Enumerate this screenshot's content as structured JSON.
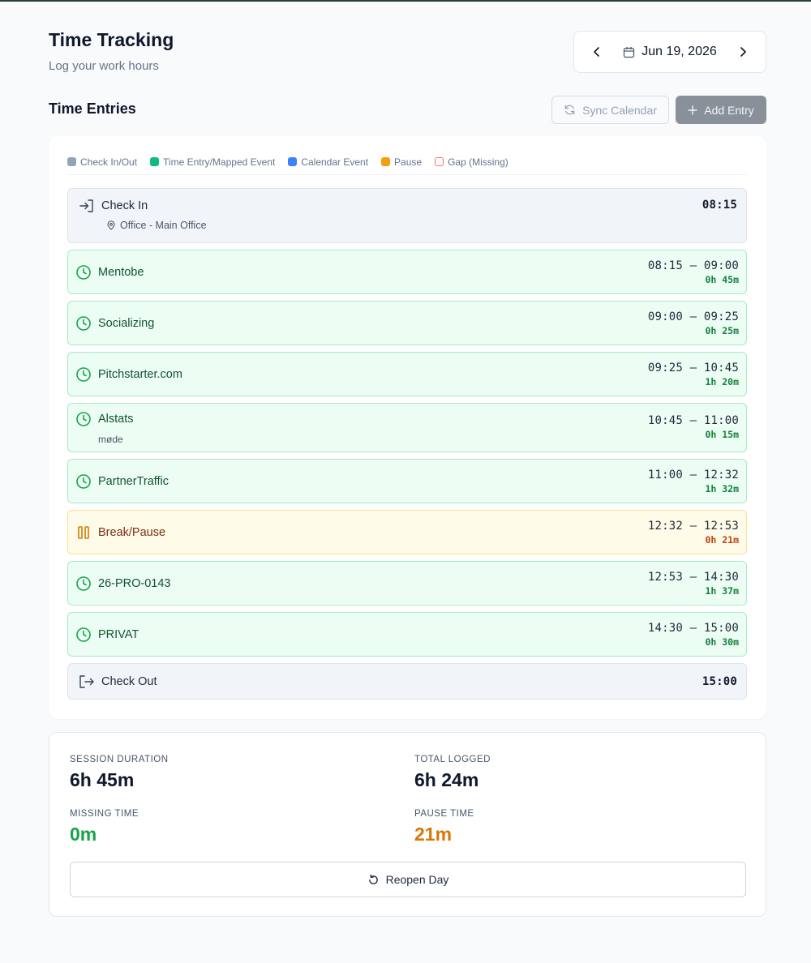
{
  "header": {
    "title": "Time Tracking",
    "subtitle": "Log your work hours",
    "date": "Jun 19, 2026"
  },
  "section": {
    "title": "Time Entries",
    "sync_label": "Sync Calendar",
    "add_label": "Add Entry"
  },
  "legend": [
    {
      "label": "Check In/Out",
      "color": "#94a3b8"
    },
    {
      "label": "Time Entry/Mapped Event",
      "color": "#10b981"
    },
    {
      "label": "Calendar Event",
      "color": "#3b82f6"
    },
    {
      "label": "Pause",
      "color": "#f59e0b"
    },
    {
      "label": "Gap (Missing)",
      "color": "#f87171"
    }
  ],
  "check_in": {
    "label": "Check In",
    "location": "Office - Main Office",
    "time": "08:15"
  },
  "entries": [
    {
      "name": "Mentobe",
      "time": "08:15 – 09:00",
      "duration": "0h 45m"
    },
    {
      "name": "Socializing",
      "time": "09:00 – 09:25",
      "duration": "0h 25m"
    },
    {
      "name": "Pitchstarter.com",
      "time": "09:25 – 10:45",
      "duration": "1h 20m"
    },
    {
      "name": "Alstats",
      "note": "møde",
      "time": "10:45 – 11:00",
      "duration": "0h 15m"
    },
    {
      "name": "PartnerTraffic",
      "time": "11:00 – 12:32",
      "duration": "1h 32m"
    },
    {
      "name": "Break/Pause",
      "time": "12:32 – 12:53",
      "duration": "0h 21m"
    },
    {
      "name": "26-PRO-0143",
      "time": "12:53 – 14:30",
      "duration": "1h 37m"
    },
    {
      "name": "PRIVAT",
      "time": "14:30 – 15:00",
      "duration": "0h 30m"
    }
  ],
  "check_out": {
    "label": "Check Out",
    "time": "15:00"
  },
  "summary": {
    "session_duration_label": "SESSION DURATION",
    "session_duration": "6h 45m",
    "total_logged_label": "TOTAL LOGGED",
    "total_logged": "6h 24m",
    "missing_time_label": "MISSING TIME",
    "missing_time": "0m",
    "pause_time_label": "PAUSE TIME",
    "pause_time": "21m",
    "reopen_label": "Reopen Day"
  },
  "colors": {
    "missing": "#16a34a",
    "pause": "#d97706"
  }
}
